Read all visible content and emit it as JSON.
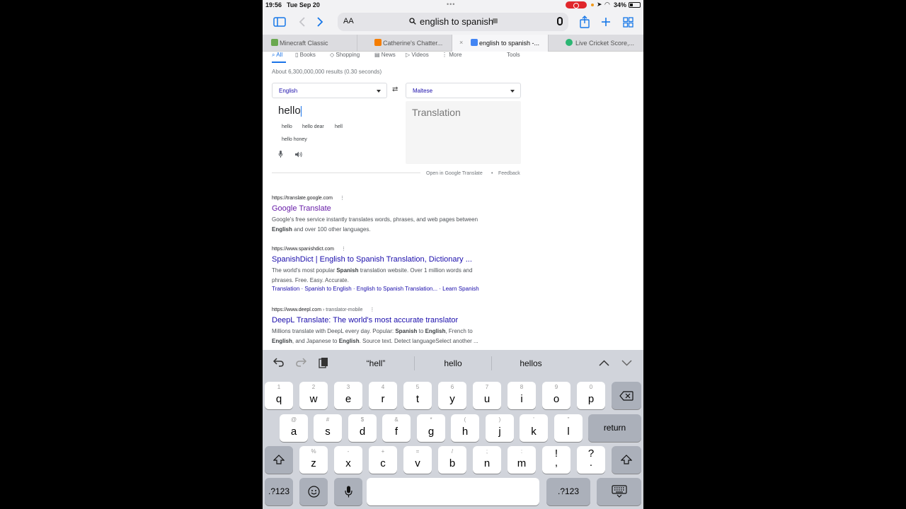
{
  "status": {
    "time": "19:56",
    "date": "Tue Sep 20",
    "battery_text": "34%",
    "battery_level": 0.34
  },
  "toolbar": {
    "aa": "AA",
    "url": "english to spanish"
  },
  "tabs": [
    {
      "label": "Minecraft Classic",
      "color": "#6aa84f"
    },
    {
      "label": "Catherine's Chatter...",
      "color": "#f57d00"
    },
    {
      "label": "english to spanish -...",
      "color": "#4285f4",
      "close": "×"
    },
    {
      "label": "Live Cricket Score,...",
      "color": "#2bb673"
    }
  ],
  "google": {
    "nav": {
      "all": "All",
      "books": "Books",
      "shopping": "Shopping",
      "news": "News",
      "videos": "Videos",
      "more": "More",
      "tools": "Tools"
    },
    "results_count": "About 6,300,000,000 results (0.30 seconds)",
    "translate": {
      "source_lang": "English",
      "target_lang": "Maltese",
      "input": "hello",
      "placeholder": "Translation",
      "suggestions": [
        "hello",
        "hello dear",
        "hell",
        "hello honey"
      ],
      "open_link": "Open in Google Translate",
      "dot": "•",
      "feedback": "Feedback"
    },
    "results": [
      {
        "cite": "https://translate.google.com",
        "title": "Google Translate",
        "desc_1": "Google's free service instantly translates words, phrases, and web pages between",
        "desc_2b": "English",
        "desc_2": " and over 100 other languages."
      },
      {
        "cite": "https://www.spanishdict.com",
        "title": "SpanishDict | English to Spanish Translation, Dictionary ...",
        "desc_1a": "The world's most popular ",
        "desc_1b": "Spanish",
        "desc_1c": " translation website. Over 1 million words and",
        "desc_2": "phrases. Free. Easy. Accurate.",
        "sublinks": "Translation · Spanish to English · English to Spanish Translation... · Learn Spanish"
      },
      {
        "cite": "https://www.deepl.com",
        "cite_path": " › translator-mobile",
        "title": "DeepL Translate: The world's most accurate translator",
        "d1a": "Millions translate with DeepL every day. Popular: ",
        "d1b": "Spanish",
        "d1c": " to ",
        "d1d": "English",
        "d1e": ", French to",
        "d2a": "English",
        "d2b": ", and Japanese to ",
        "d2c": "English",
        "d2d": ". Source text. Detect languageSelect another ..."
      }
    ]
  },
  "keyboard": {
    "predictions": [
      "“hell”",
      "hello",
      "hellos"
    ],
    "row1": [
      [
        "1",
        "q"
      ],
      [
        "2",
        "w"
      ],
      [
        "3",
        "e"
      ],
      [
        "4",
        "r"
      ],
      [
        "5",
        "t"
      ],
      [
        "6",
        "y"
      ],
      [
        "7",
        "u"
      ],
      [
        "8",
        "i"
      ],
      [
        "9",
        "o"
      ],
      [
        "0",
        "p"
      ]
    ],
    "row2": [
      [
        "@",
        "a"
      ],
      [
        "#",
        "s"
      ],
      [
        "$",
        "d"
      ],
      [
        "&",
        "f"
      ],
      [
        "*",
        "g"
      ],
      [
        "(",
        "h"
      ],
      [
        ")",
        "j"
      ],
      [
        "'",
        "k"
      ],
      [
        "\"",
        "l"
      ]
    ],
    "row3": [
      [
        "%",
        "z"
      ],
      [
        "-",
        "x"
      ],
      [
        "+",
        "c"
      ],
      [
        "=",
        "v"
      ],
      [
        "/",
        "b"
      ],
      [
        ";",
        "n"
      ],
      [
        ":",
        "m"
      ],
      [
        "",
        "!\n,"
      ],
      [
        "",
        "?\n."
      ]
    ],
    "return": "return",
    "num": ".?123"
  }
}
